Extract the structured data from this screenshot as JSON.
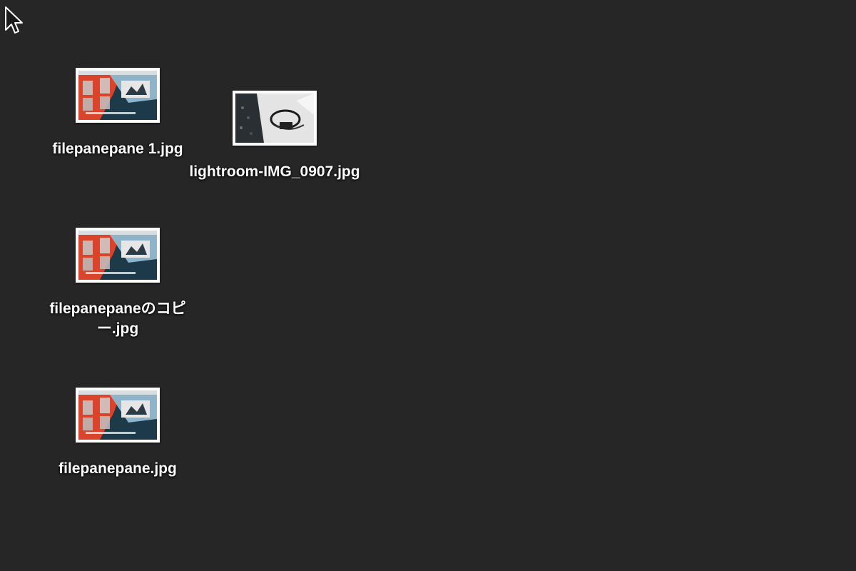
{
  "desktop": {
    "background": "#262626",
    "cursor": "arrow-pointer-icon",
    "files": [
      {
        "name": "filepanepane 1.jpg",
        "thumbnail": "screenshot-thumbnail"
      },
      {
        "name": "lightroom-IMG_0907.jpg",
        "thumbnail": "photo-thumbnail"
      },
      {
        "name": "filepanepaneのコピー.jpg",
        "thumbnail": "screenshot-thumbnail"
      },
      {
        "name": "filepanepane.jpg",
        "thumbnail": "screenshot-thumbnail"
      }
    ]
  }
}
